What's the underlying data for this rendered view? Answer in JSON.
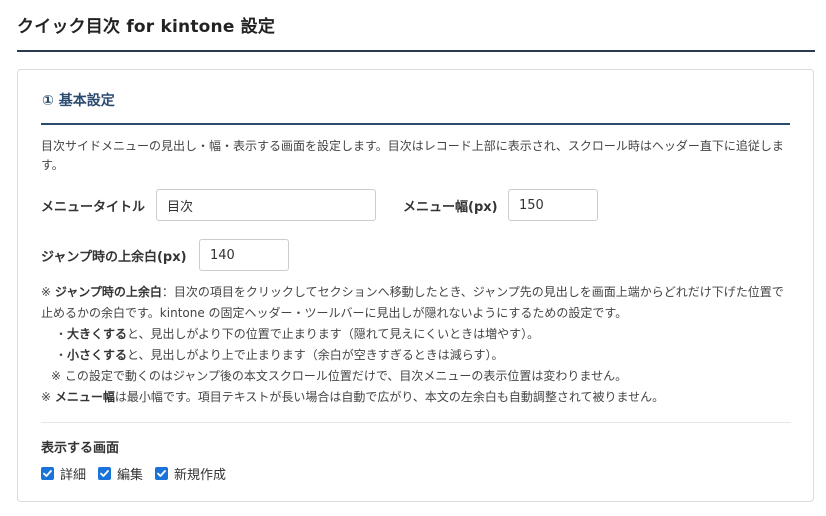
{
  "page": {
    "title": "クイック目次 for kintone 設定"
  },
  "section": {
    "heading": "① 基本設定",
    "description": "目次サイドメニューの見出し・幅・表示する画面を設定します。目次はレコード上部に表示され、スクロール時はヘッダー直下に追従します。"
  },
  "fields": {
    "menu_title": {
      "label": "メニュータイトル",
      "value": "目次"
    },
    "menu_width": {
      "label": "メニュー幅(px)",
      "value": "150"
    },
    "jump_margin": {
      "label": "ジャンプ時の上余白(px)",
      "value": "140"
    }
  },
  "notes": {
    "jump_prefix": "※ ",
    "jump_title": "ジャンプ時の上余白",
    "jump_line1": "：目次の項目をクリックしてセクションへ移動したとき、ジャンプ先の見出しを画面上端からどれだけ下げた位置で",
    "jump_line2": "止めるかの余白です。kintone の固定ヘッダー・ツールバーに見出しが隠れないようにするための設定です。",
    "bigger_prefix": "・",
    "bigger_bold": "大きくする",
    "bigger_text": "と、見出しがより下の位置で止まります（隠れて見えにくいときは増やす）。",
    "smaller_prefix": "・",
    "smaller_bold": "小さくする",
    "smaller_text": "と、見出しがより上で止まります（余白が空きすぎるときは減らす）。",
    "scroll_note": "※ この設定で動くのはジャンプ後の本文スクロール位置だけで、目次メニューの表示位置は変わりません。",
    "width_prefix": "※ ",
    "width_bold": "メニュー幅",
    "width_text": "は最小幅です。項目テキストが長い場合は自動で広がり、本文の左余白も自動調整されて被りません。"
  },
  "screens": {
    "heading": "表示する画面",
    "options": [
      {
        "label": "詳細",
        "checked": true
      },
      {
        "label": "編集",
        "checked": true
      },
      {
        "label": "新規作成",
        "checked": true
      }
    ]
  },
  "colors": {
    "accent": "#2b4a6f",
    "checkbox": "#1a73d9"
  }
}
